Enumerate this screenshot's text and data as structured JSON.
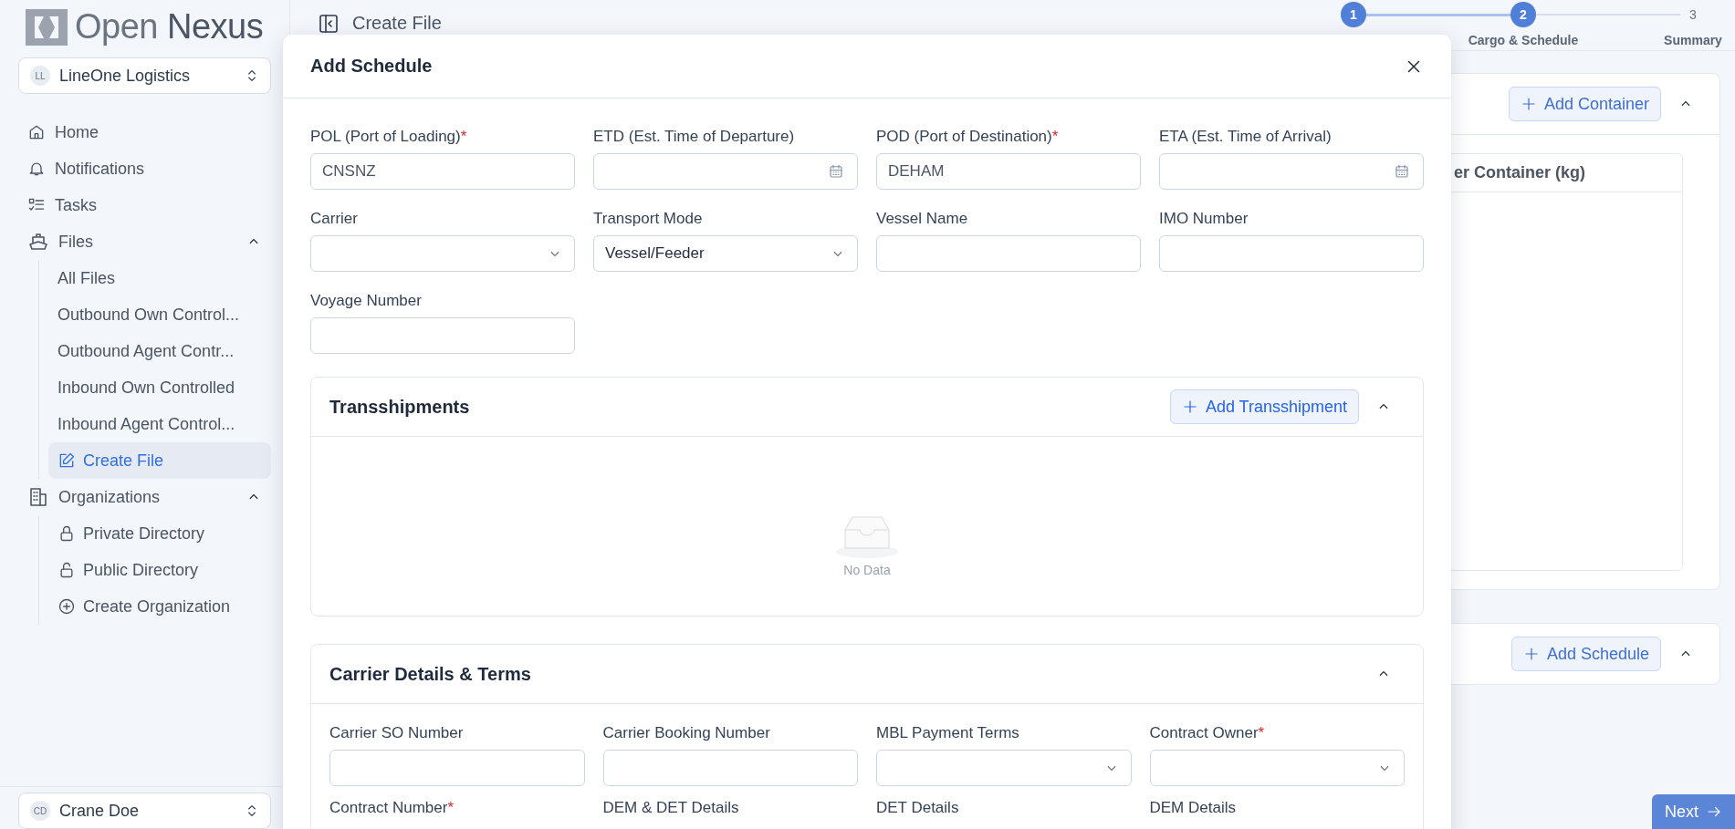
{
  "sidebar": {
    "logo": "Open **Nexus**",
    "workspace": {
      "initials": "LL",
      "name": "LineOne Logistics"
    },
    "nav": [
      {
        "label": "Home",
        "selected": false
      },
      {
        "label": "Notifications",
        "selected": false
      },
      {
        "label": "Tasks",
        "selected": false
      },
      {
        "label": "Files",
        "selected": false,
        "expanded": true,
        "children": [
          {
            "label": "All Files",
            "selected": false
          },
          {
            "label": "Outbound Own Control...",
            "selected": false
          },
          {
            "label": "Outbound Agent Contr...",
            "selected": false
          },
          {
            "label": "Inbound Own Controlled",
            "selected": false
          },
          {
            "label": "Inbound Agent Control...",
            "selected": false
          },
          {
            "label": "Create File",
            "selected": true
          }
        ]
      },
      {
        "label": "Organizations",
        "selected": false,
        "expanded": true,
        "children": [
          {
            "label": "Private Directory",
            "selected": false
          },
          {
            "label": "Public Directory",
            "selected": false
          },
          {
            "label": "Create Organization",
            "selected": false
          }
        ]
      }
    ],
    "user": {
      "initials": "CD",
      "name": "Crane Doe"
    }
  },
  "header": {
    "title": "Create File",
    "steps": [
      {
        "number": "1",
        "reached": true
      },
      {
        "number": "2",
        "label": "Cargo & Schedule",
        "reached": true
      },
      {
        "number": "3",
        "label": "Summary",
        "reached": false
      }
    ]
  },
  "background": {
    "container_section": {
      "button": "Add Container",
      "expanded": true,
      "column": "er Container (kg)"
    },
    "schedule_section": {
      "button": "Add Schedule",
      "expanded": true
    },
    "next_button": "Next"
  },
  "modal": {
    "title": "Add Schedule",
    "fields": [
      {
        "label": "POL (Port of Loading)",
        "required_mark": "*",
        "kind": "text",
        "value": "CNSNZ"
      },
      {
        "label": "ETD (Est. Time of Departure)",
        "kind": "date"
      },
      {
        "label": "POD (Port of Destination)",
        "required_mark": "*",
        "kind": "text",
        "value": "DEHAM"
      },
      {
        "label": "ETA (Est. Time of Arrival)",
        "kind": "date"
      },
      {
        "label": "Carrier",
        "kind": "select"
      },
      {
        "label": "Transport Mode",
        "kind": "select",
        "value": "Vessel/Feeder"
      },
      {
        "label": "Vessel Name",
        "kind": "text"
      },
      {
        "label": "IMO Number",
        "kind": "text"
      },
      {
        "label": "Voyage Number",
        "kind": "text"
      }
    ],
    "transshipments": {
      "title": "Transshipments",
      "button": "Add Transshipment",
      "expanded": true,
      "empty_text": "No Data"
    },
    "carrier_details": {
      "title": "Carrier Details & Terms",
      "expanded": true,
      "fields": [
        {
          "label": "Carrier SO Number",
          "kind": "text"
        },
        {
          "label": "Carrier Booking Number",
          "kind": "text"
        },
        {
          "label": "MBL Payment Terms",
          "kind": "select"
        },
        {
          "label": "Contract Owner",
          "required_mark": "*",
          "kind": "select"
        },
        {
          "label": "Contract Number",
          "required_mark": "*",
          "kind": "label"
        },
        {
          "label": "DEM & DET Details",
          "kind": "label"
        },
        {
          "label": "DET Details",
          "kind": "label"
        },
        {
          "label": "DEM Details",
          "kind": "label"
        }
      ]
    }
  }
}
